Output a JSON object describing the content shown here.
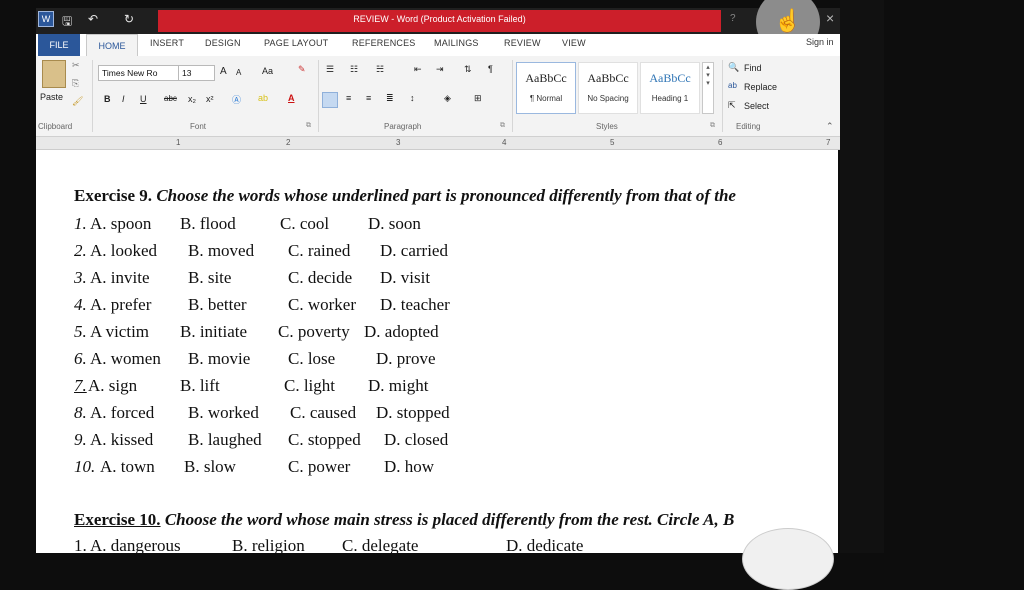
{
  "window": {
    "title": "REVIEW - Word (Product Activation Failed)",
    "help": "?",
    "close": "×",
    "overlay_glyph": "☝"
  },
  "tabs": [
    "FILE",
    "HOME",
    "INSERT",
    "DESIGN",
    "PAGE LAYOUT",
    "REFERENCES",
    "MAILINGS",
    "REVIEW",
    "VIEW"
  ],
  "signin": "Sign in",
  "ribbon": {
    "clipboard": {
      "paste": "Paste",
      "label": "Clipboard"
    },
    "font": {
      "name": "Times New Ro",
      "size": "13",
      "label": "Font",
      "grow": "A",
      "shrink": "A",
      "case": "Aa",
      "bold": "B",
      "italic": "I",
      "underline": "U",
      "strike": "abc",
      "sub": "x₂",
      "sup": "x²"
    },
    "paragraph": {
      "label": "Paragraph",
      "pilcrow": "¶"
    },
    "styles": {
      "label": "Styles",
      "items": [
        {
          "sample": "AaBbCc",
          "name": "¶ Normal"
        },
        {
          "sample": "AaBbCc",
          "name": "No Spacing"
        },
        {
          "sample": "AaBbCc",
          "name": "Heading 1"
        }
      ]
    },
    "editing": {
      "label": "Editing",
      "find": "Find",
      "replace": "Replace",
      "select": "Select"
    }
  },
  "ruler": {
    "numbers": [
      "1",
      "2",
      "3",
      "4",
      "5",
      "6",
      "7"
    ]
  },
  "exercise9": {
    "title_bold": "Exercise 9.",
    "title_italic": " Choose the words whose underlined part is pronounced differently from that of the",
    "rows": [
      {
        "n": "1.",
        "a": "A. spoon",
        "b": "B. flood",
        "c": "C. cool",
        "d": "D. soon"
      },
      {
        "n": "2.",
        "a": "A. looked",
        "b": "B. moved",
        "c": "C. rained",
        "d": "D. carried"
      },
      {
        "n": "3.",
        "a": "A. invite",
        "b": "B. site",
        "c": "C. decide",
        "d": "D. visit"
      },
      {
        "n": "4.",
        "a": "A. prefer",
        "b": "B. better",
        "c": "C. worker",
        "d": "D. teacher"
      },
      {
        "n": "5.",
        "a": "A victim",
        "b": "B. initiate",
        "c": "C. poverty",
        "d": "D. adopted"
      },
      {
        "n": "6.",
        "a": "A. women",
        "b": "B. movie",
        "c": "C. lose",
        "d": "D. prove"
      },
      {
        "n": "7.",
        "a": "A. sign",
        "b": "B. lift",
        "c": "C. light",
        "d": "D. might"
      },
      {
        "n": "8.",
        "a": "A. forced",
        "b": "B. worked",
        "c": "C. caused",
        "d": "D. stopped"
      },
      {
        "n": "9.",
        "a": "A. kissed",
        "b": "B. laughed",
        "c": "C. stopped",
        "d": "D. closed"
      },
      {
        "n": "10.",
        "a": "A. town",
        "b": "B. slow",
        "c": "C. power",
        "d": "D. how"
      }
    ]
  },
  "exercise10": {
    "title_bold": "Exercise 10.",
    "title_italic": " Choose the word whose main stress is placed differently from the rest. Circle A, B",
    "row1": {
      "n": "1.",
      "a": "A. dangerous",
      "b": "B. religion",
      "c": "C. delegate",
      "d": "D. dedicate"
    }
  }
}
